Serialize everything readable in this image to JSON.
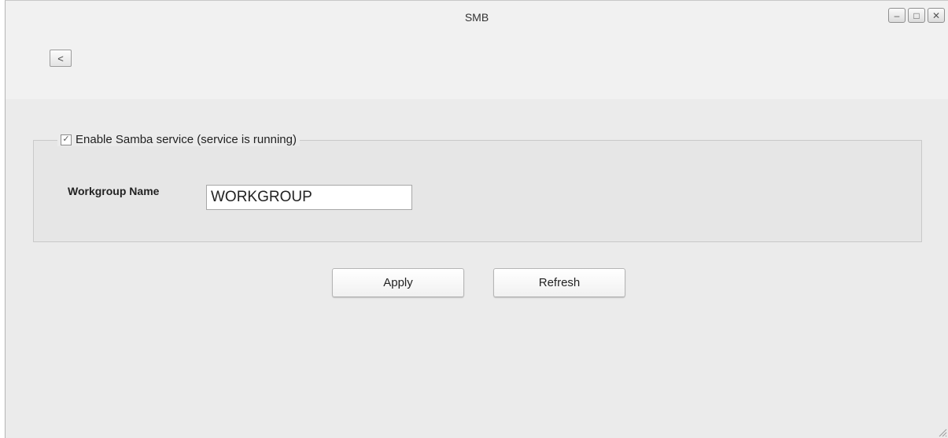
{
  "window": {
    "title": "SMB",
    "controls": [
      {
        "name": "minimize",
        "glyph": "–"
      },
      {
        "name": "maximize",
        "glyph": "□"
      },
      {
        "name": "close",
        "glyph": "✕"
      }
    ]
  },
  "nav": {
    "back_label": "<"
  },
  "samba": {
    "enable_checked": true,
    "check_glyph": "✓",
    "enable_label": "Enable Samba service (service is running)",
    "workgroup_label": "Workgroup Name",
    "workgroup_value": "WORKGROUP"
  },
  "actions": {
    "apply_label": "Apply",
    "refresh_label": "Refresh"
  },
  "colors": {
    "window_bg": "#f1f1f1",
    "content_bg": "#ebebeb",
    "group_bg": "#e6e6e6"
  }
}
